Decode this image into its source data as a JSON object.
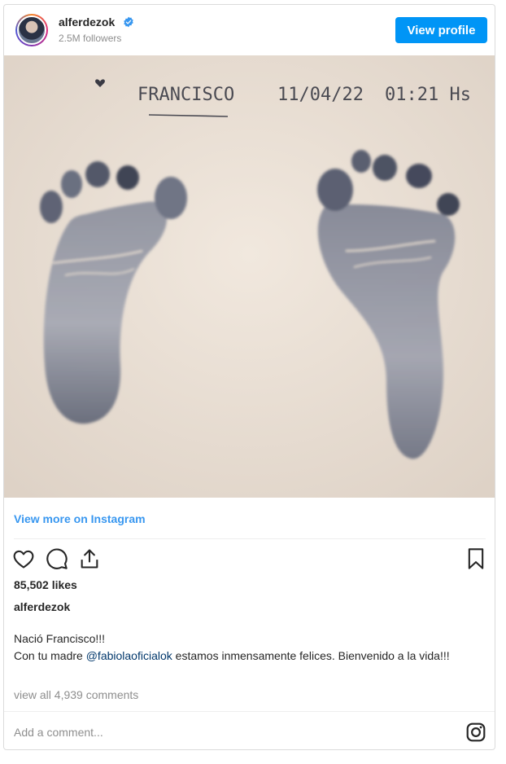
{
  "header": {
    "username": "alferdezok",
    "followers": "2.5M followers",
    "view_profile_label": "View profile"
  },
  "image": {
    "handwriting": {
      "name": "FRANCISCO",
      "date": "11/04/22",
      "time": "01:21 Hs"
    },
    "icon": "footprints-photo"
  },
  "links": {
    "view_more": "View more on Instagram"
  },
  "actions": {
    "icons": [
      "heart-icon",
      "comment-icon",
      "share-icon",
      "bookmark-icon"
    ]
  },
  "stats": {
    "likes": "85,502 likes"
  },
  "caption": {
    "owner": "alferdezok",
    "line1": "Nació Francisco!!!",
    "line2_before": "Con tu madre ",
    "mention": "@fabiolaoficialok",
    "line2_after": " estamos inmensamente felices. Bienvenido a la vida!!!"
  },
  "comments": {
    "view_all": "view all 4,939 comments",
    "placeholder": "Add a comment..."
  },
  "colors": {
    "accent": "#0095f6",
    "link": "#3897f0",
    "verified": "#3897f0",
    "paper": "#ece2d8",
    "ink": "#4d5566"
  }
}
